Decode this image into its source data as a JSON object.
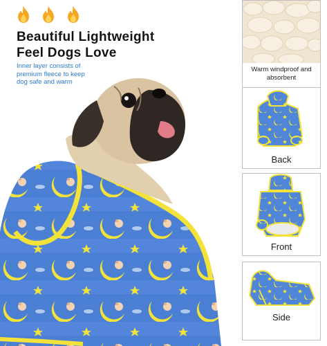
{
  "headline": {
    "line1": "Beautiful Lightweight",
    "line2": "Feel Dogs Love"
  },
  "subtext": {
    "line1": "Inner layer consists of",
    "line2": "premium fleece to keep",
    "line3": "dog safe and warm"
  },
  "icons": [
    "flame-icon",
    "flame-icon",
    "flame-icon"
  ],
  "panels": {
    "fleece_caption_line1": "Warm windproof and",
    "fleece_caption_line2": "absorbent",
    "back_label": "Back",
    "front_label": "Front",
    "side_label": "Side"
  },
  "colors": {
    "headline": "#141414",
    "subtext": "#2c7bd3",
    "fabric_blue": "#4a7fd4",
    "trim_yellow": "#f3e23a",
    "flame": "#f5a623"
  }
}
